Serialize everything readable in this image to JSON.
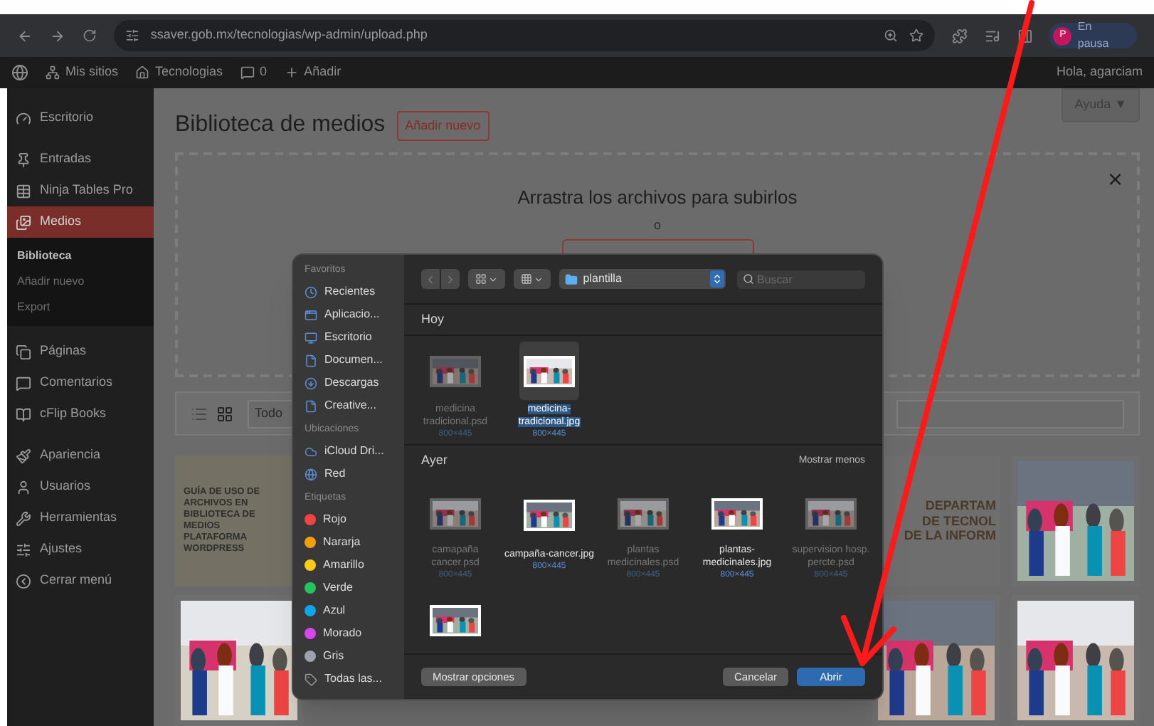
{
  "browser": {
    "url": "ssaver.gob.mx/tecnologias/wp-admin/upload.php",
    "avatar_letter": "P",
    "profile": "En pausa"
  },
  "admin_bar": {
    "items": [
      "Mis sitios",
      "Tecnologias",
      "0",
      "Añadir"
    ],
    "greeting": "Hola, agarciam"
  },
  "sidebar": {
    "groups": [
      {
        "items": [
          {
            "label": "Escritorio",
            "selected": false
          }
        ]
      },
      {
        "items": [
          {
            "label": "Entradas",
            "selected": false
          },
          {
            "label": "Ninja Tables Pro",
            "selected": false
          },
          {
            "label": "Medios",
            "selected": true,
            "children": [
              {
                "label": "Biblioteca",
                "selected": true
              },
              {
                "label": "Añadir nuevo",
                "selected": false
              },
              {
                "label": "Export",
                "selected": false
              }
            ]
          }
        ]
      },
      {
        "items": [
          {
            "label": "Páginas",
            "selected": false
          },
          {
            "label": "Comentarios",
            "selected": false
          },
          {
            "label": "cFlip Books",
            "selected": false
          }
        ]
      },
      {
        "items": [
          {
            "label": "Apariencia",
            "selected": false
          },
          {
            "label": "Usuarios",
            "selected": false
          },
          {
            "label": "Herramientas",
            "selected": false
          },
          {
            "label": "Ajustes",
            "selected": false
          },
          {
            "label": "Cerrar menú",
            "selected": false
          }
        ]
      }
    ]
  },
  "page": {
    "title": "Biblioteca de medios",
    "add_button": "Añadir nuevo",
    "help_tab": "Ayuda ▼",
    "dropzone_title": "Arrastra los archivos para subirlos",
    "dropzone_or": "o",
    "close": "×",
    "filter": "Todo",
    "media": [
      {
        "kind": "guide",
        "text": "GUÍA DE USO DE ARCHIVOS EN BIBLIOTECA DE MEDIOS PLATAFORMA WORDPRESS"
      },
      {
        "kind": "department",
        "lines": [
          "DEPARTAM",
          "DE TECNOL",
          "DE LA INFORM"
        ]
      },
      {
        "kind": "picture"
      },
      {
        "kind": "picture"
      },
      {
        "kind": "picture"
      },
      {
        "kind": "picture"
      }
    ]
  },
  "dialog": {
    "sidebar": [
      {
        "heading": "Favoritos",
        "items": [
          {
            "label": "Recientes"
          },
          {
            "label": "Aplicacio..."
          },
          {
            "label": "Escritorio"
          },
          {
            "label": "Documen..."
          },
          {
            "label": "Descargas"
          },
          {
            "label": "Creative..."
          }
        ]
      },
      {
        "heading": "Ubicaciones",
        "items": [
          {
            "label": "iCloud Dri..."
          },
          {
            "label": "Red"
          }
        ]
      },
      {
        "heading": "Etiquetas",
        "items": [
          {
            "label": "Rojo",
            "color": "#ef4444"
          },
          {
            "label": "Nararja",
            "color": "#f59e0b"
          },
          {
            "label": "Amarillo",
            "color": "#facc15"
          },
          {
            "label": "Verde",
            "color": "#22c55e"
          },
          {
            "label": "Azul",
            "color": "#0ea5e9"
          },
          {
            "label": "Morado",
            "color": "#d946ef"
          },
          {
            "label": "Gris",
            "color": "#9ca3af"
          },
          {
            "label": "Todas las..."
          }
        ]
      }
    ],
    "location": "plantilla",
    "search_placeholder": "Buscar",
    "sections": [
      {
        "title": "Hoy",
        "files": [
          {
            "name": "medicina tradicional.psd",
            "size": "800×445",
            "disabled": true,
            "selected": false
          },
          {
            "name": "medicina-tradicional.jpg",
            "size": "800×445",
            "disabled": false,
            "selected": true
          }
        ]
      },
      {
        "title": "Ayer",
        "action": "Mostrar menos",
        "files": [
          {
            "name": "camapaña cancer.psd",
            "size": "800×445",
            "disabled": true,
            "selected": false
          },
          {
            "name": "campaña-cancer.jpg",
            "size": "800×445",
            "disabled": false,
            "selected": false
          },
          {
            "name": "plantas medicinales.psd",
            "size": "800×445",
            "disabled": true,
            "selected": false
          },
          {
            "name": "plantas-medicinales.jpg",
            "size": "800×445",
            "disabled": false,
            "selected": false
          },
          {
            "name": "supervision hosp. percte.psd",
            "size": "800×445",
            "disabled": true,
            "selected": false
          },
          {
            "disabled": false,
            "selected": false
          }
        ]
      }
    ],
    "options_button": "Mostrar opciones",
    "cancel_button": "Cancelar",
    "open_button": "Abrir"
  }
}
